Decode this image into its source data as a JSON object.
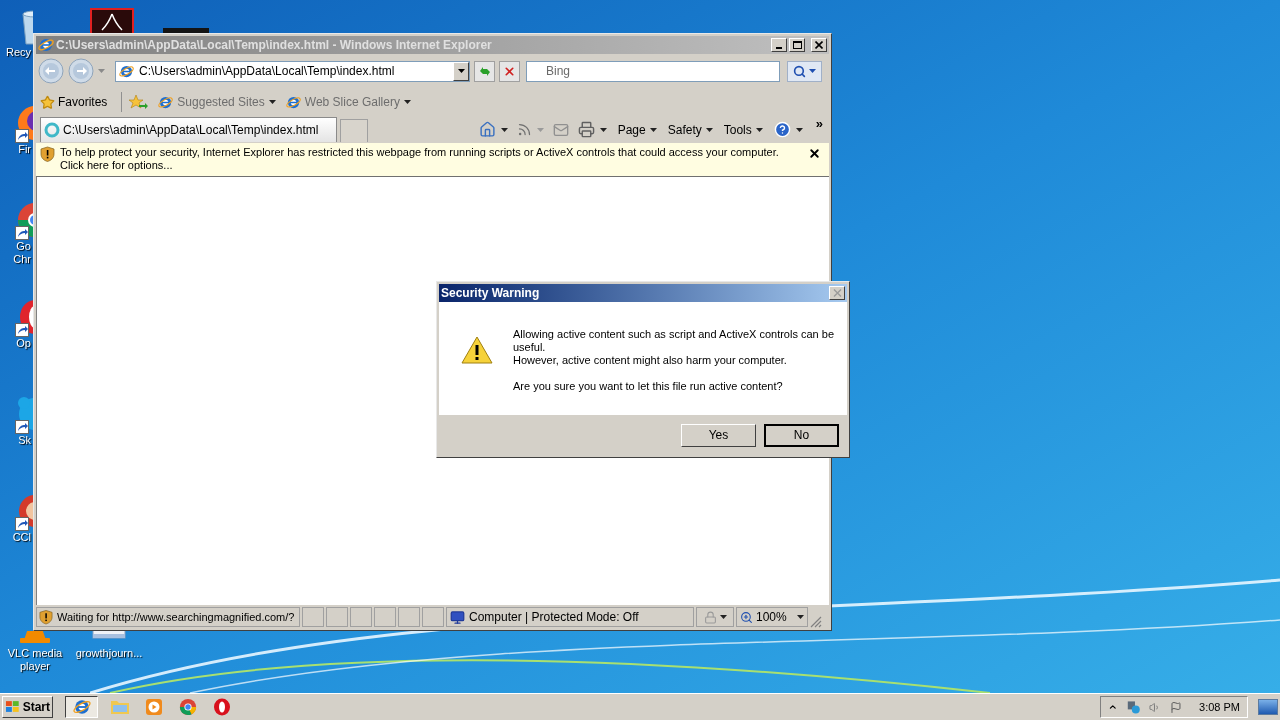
{
  "desktop": {
    "icons": [
      {
        "kind": "recycle-bin",
        "label": "Recy"
      },
      {
        "kind": "firefox",
        "label": "Fir"
      },
      {
        "kind": "chrome",
        "label": "Go\nChr"
      },
      {
        "kind": "opera",
        "label": "Op"
      },
      {
        "kind": "skype",
        "label": "Sk"
      },
      {
        "kind": "ccleaner",
        "label": "CCl"
      },
      {
        "kind": "vlc",
        "label": "VLC media\nplayer"
      },
      {
        "kind": "document",
        "label": "growthjourn..."
      }
    ]
  },
  "browser": {
    "title": "C:\\Users\\admin\\AppData\\Local\\Temp\\index.html - Windows Internet Explorer",
    "address": "C:\\Users\\admin\\AppData\\Local\\Temp\\index.html",
    "search": {
      "placeholder": "Bing"
    },
    "favorites": "Favorites",
    "favorite_links": [
      "Suggested Sites",
      "Web Slice Gallery"
    ],
    "tabs": [
      {
        "label": "C:\\Users\\admin\\AppData\\Local\\Temp\\index.html",
        "selected": true
      }
    ],
    "commands": [
      "Page",
      "Safety",
      "Tools"
    ],
    "more": "»",
    "infobar": "To help protect your security, Internet Explorer has restricted this webpage from running scripts or ActiveX controls that could access your computer. Click here for options...",
    "status_bar": {
      "text": "Waiting for http://www.searchingmagnified.com/?",
      "zone": "Computer | Protected Mode: Off",
      "zoom": "100%"
    }
  },
  "dialog": {
    "title": "Security Warning",
    "messages": [
      "Allowing active content such as script and ActiveX controls can be useful.",
      "However, active content might also harm your computer.",
      "Are you sure you want to let this file run active content?"
    ],
    "buttons": [
      {
        "label": "Yes",
        "default": false
      },
      {
        "label": "No",
        "default": true
      }
    ]
  },
  "taskbar": {
    "start": "Start",
    "apps": [
      {
        "kind": "ie",
        "active": true
      },
      {
        "kind": "folder",
        "active": false
      },
      {
        "kind": "media",
        "active": false
      },
      {
        "kind": "chrome",
        "active": false
      },
      {
        "kind": "opera",
        "active": false
      }
    ],
    "clock": "3:08 PM"
  }
}
